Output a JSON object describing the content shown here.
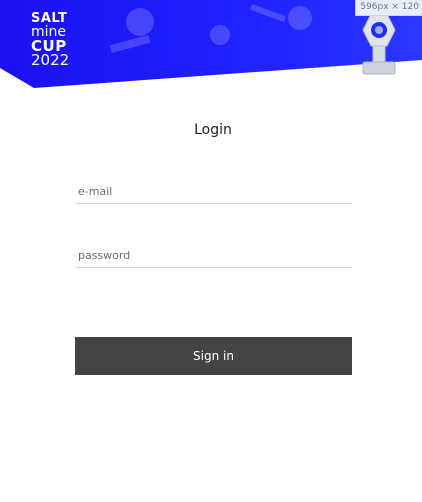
{
  "brand": {
    "line1": "SALT",
    "line2": "mine",
    "line3": "CUP",
    "line4": "2022"
  },
  "dimension_badge": "596px × 120",
  "login": {
    "title": "Login",
    "email_placeholder": "e-mail",
    "password_placeholder": "password",
    "submit_label": "Sign in"
  },
  "colors": {
    "banner_blue": "#1a1aff",
    "button_dark": "#444444"
  },
  "icons": {
    "trophy": "trophy-icon"
  }
}
